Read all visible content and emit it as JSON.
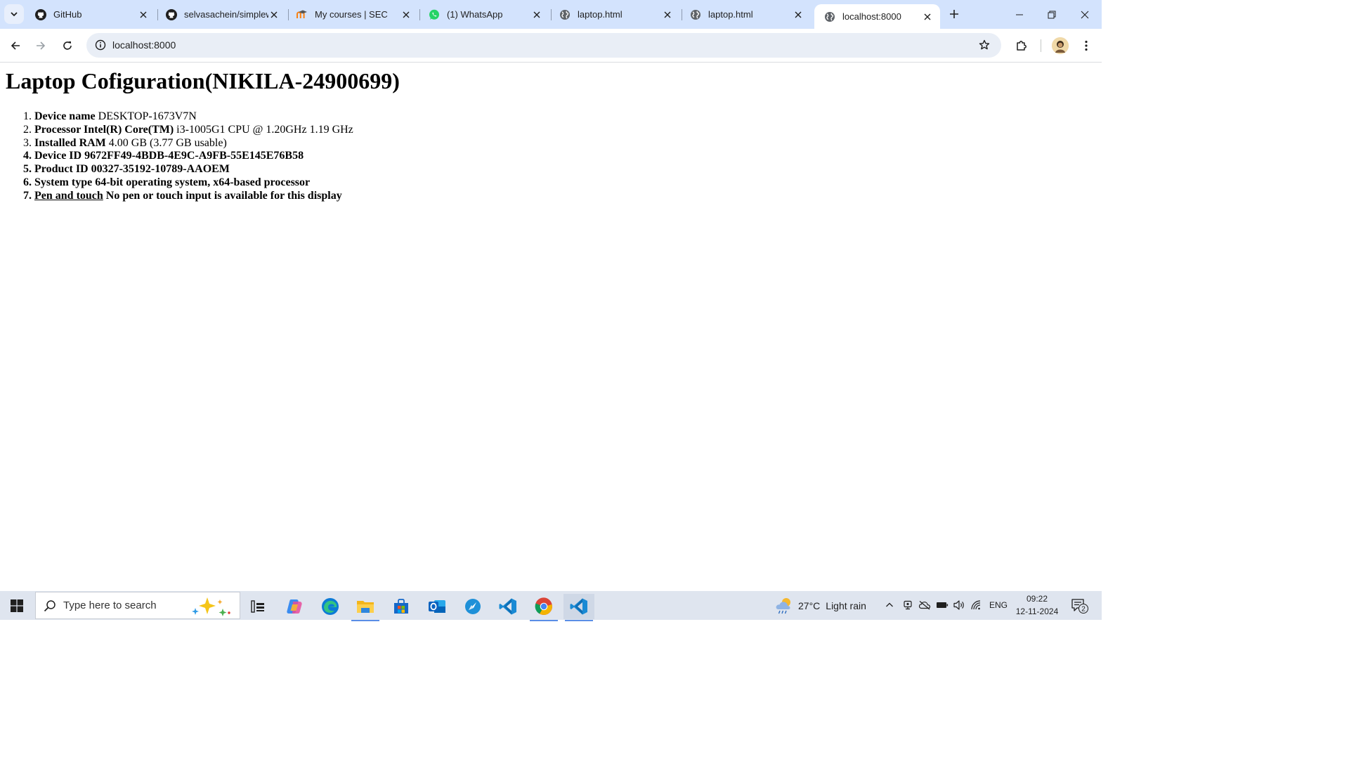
{
  "browser": {
    "tabs": [
      {
        "title": "GitHub",
        "icon": "github-icon",
        "active": false
      },
      {
        "title": "selvasachein/simplew",
        "icon": "github-icon",
        "active": false
      },
      {
        "title": "My courses | SEC",
        "icon": "moodle-icon",
        "active": false
      },
      {
        "title": "(1) WhatsApp",
        "icon": "whatsapp-icon",
        "active": false
      },
      {
        "title": "laptop.html",
        "icon": "globe-icon",
        "active": false
      },
      {
        "title": "laptop.html",
        "icon": "globe-icon",
        "active": false
      },
      {
        "title": "localhost:8000",
        "icon": "globe-icon",
        "active": true
      }
    ],
    "address_bar": {
      "url": "localhost:8000"
    }
  },
  "page": {
    "heading": "Laptop Cofiguration(NIKILA-24900699)",
    "items": [
      {
        "label": "Device name",
        "value": "DESKTOP-1673V7N"
      },
      {
        "label": "Processor Intel(R) Core(TM)",
        "value": "i3-1005G1 CPU @ 1.20GHz 1.19 GHz"
      },
      {
        "label": "Installed RAM",
        "value": "4.00 GB (3.77 GB usable)"
      },
      {
        "label": "Device ID",
        "value": "9672FF49-4BDB-4E9C-A9FB-55E145E76B58"
      },
      {
        "label": "Product ID",
        "value": "00327-35192-10789-AAOEM"
      },
      {
        "label": "System type",
        "value": "64-bit operating system, x64-based processor"
      },
      {
        "label": "Pen and touch",
        "value": "No pen or touch input is available for this display"
      }
    ]
  },
  "taskbar": {
    "search_placeholder": "Type here to search",
    "weather": {
      "temp": "27°C",
      "condition": "Light rain"
    },
    "language": "ENG",
    "time": "09:22",
    "date": "12-11-2024",
    "notification_count": "2"
  },
  "colors": {
    "tabstrip": "#d3e3fd",
    "omnibox": "#e9eef6",
    "taskbar": "#dfe5ef",
    "taskbar_indicator": "#5a8ee6"
  }
}
